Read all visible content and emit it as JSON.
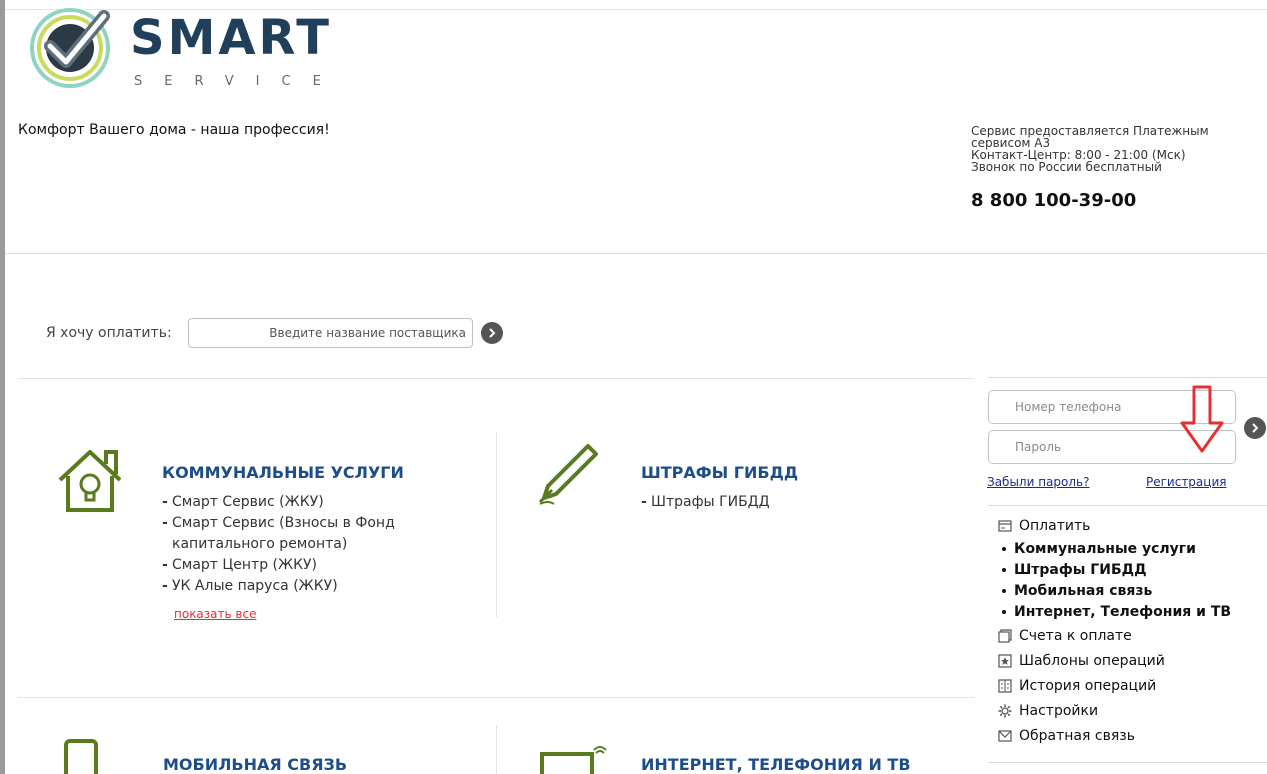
{
  "header": {
    "logo_word": "SMART",
    "logo_sub": "SERVICE",
    "tagline": "Комфорт Вашего дома - наша профессия!",
    "service_line1": "Сервис предоставляется Платежным",
    "service_line2": "сервисом А3",
    "service_line3": "Контакт-Центр: 8:00 - 21:00 (Мск)",
    "service_line4": "Звонок по России бесплатный",
    "phone": "8 800 100-39-00"
  },
  "search": {
    "label": "Я хочу оплатить:",
    "placeholder": "Введите название поставщика"
  },
  "categories": [
    {
      "title": "КОММУНАЛЬНЫЕ УСЛУГИ",
      "icon": "house-bulb-icon",
      "items": [
        "Смарт Сервис (ЖКУ)",
        "Смарт Сервис (Взносы в Фонд",
        "капитального ремонта)",
        "Смарт Центр (ЖКУ)",
        "УК Алые паруса (ЖКУ)"
      ],
      "show_all": "показать все"
    },
    {
      "title": "ШТРАФЫ ГИБДД",
      "icon": "pen-icon",
      "items": [
        "Штрафы ГИБДД"
      ]
    },
    {
      "title": "МОБИЛЬНАЯ СВЯЗЬ",
      "icon": "mobile-phone-icon"
    },
    {
      "title": "ИНТЕРНЕТ, ТЕЛЕФОНИЯ И ТВ",
      "icon": "monitor-wifi-icon"
    }
  ],
  "login": {
    "phone_placeholder": "Номер телефона",
    "password_placeholder": "Пароль",
    "forgot": "Забыли пароль?",
    "register": "Регистрация"
  },
  "menu": {
    "pay": "Оплатить",
    "pay_items": [
      "Коммунальные услуги",
      "Штрафы ГИБДД",
      "Мобильная связь",
      "Интернет, Телефония и ТВ"
    ],
    "bills": "Счета к оплате",
    "templates": "Шаблоны операций",
    "history": "История операций",
    "settings": "Настройки",
    "feedback": "Обратная связь"
  },
  "colors": {
    "title_blue": "#1d4e89",
    "icon_green": "#5a7a1e",
    "link_red": "#e03030",
    "arrow_red": "#e53030",
    "logo_dark": "#1f3f5a"
  }
}
